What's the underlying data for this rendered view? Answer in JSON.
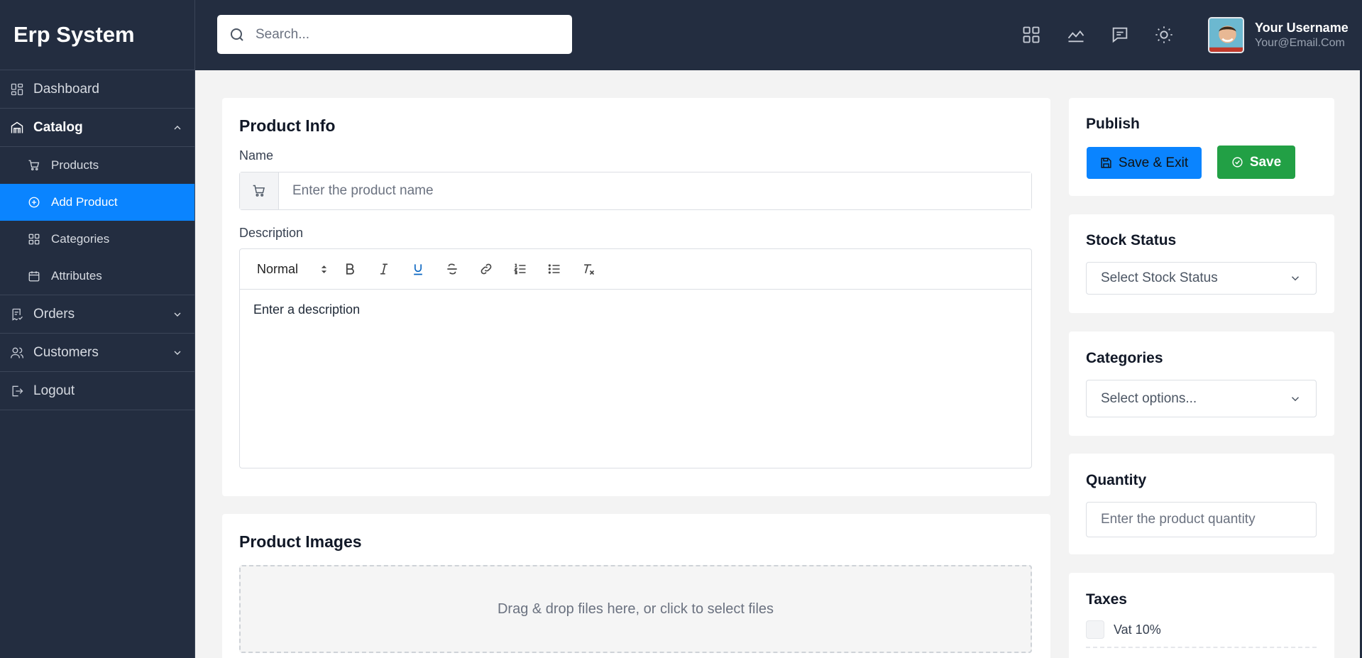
{
  "app": {
    "title": "Erp System"
  },
  "sidebar": {
    "items": [
      {
        "label": "Dashboard",
        "icon": "dashboard-icon"
      },
      {
        "label": "Catalog",
        "icon": "store-icon",
        "expanded": true,
        "children": [
          {
            "label": "Products",
            "icon": "cart-icon"
          },
          {
            "label": "Add Product",
            "icon": "plus-circle-icon",
            "selected": true
          },
          {
            "label": "Categories",
            "icon": "grid-icon"
          },
          {
            "label": "Attributes",
            "icon": "calendar-icon"
          }
        ]
      },
      {
        "label": "Orders",
        "icon": "receipt-icon"
      },
      {
        "label": "Customers",
        "icon": "users-icon"
      },
      {
        "label": "Logout",
        "icon": "logout-icon"
      }
    ]
  },
  "header": {
    "search_placeholder": "Search...",
    "icons": [
      "apps-grid-icon",
      "chart-icon",
      "message-icon",
      "sun-icon"
    ],
    "user": {
      "name": "Your Username",
      "email": "Your@Email.Com"
    }
  },
  "product_info": {
    "title": "Product Info",
    "name_label": "Name",
    "name_placeholder": "Enter the product name",
    "description_label": "Description",
    "editor": {
      "format": "Normal",
      "tools": [
        "bold",
        "italic",
        "underline",
        "strikethrough",
        "link",
        "ordered-list",
        "bullet-list",
        "clear-format"
      ],
      "placeholder": "Enter a description"
    }
  },
  "product_images": {
    "title": "Product Images",
    "dropzone_text": "Drag & drop files here, or click to select files"
  },
  "publish": {
    "title": "Publish",
    "save_exit_label": "Save & Exit",
    "save_label": "Save"
  },
  "stock_status": {
    "title": "Stock Status",
    "placeholder": "Select Stock Status"
  },
  "categories": {
    "title": "Categories",
    "placeholder": "Select options..."
  },
  "quantity": {
    "title": "Quantity",
    "placeholder": "Enter the product quantity"
  },
  "taxes": {
    "title": "Taxes",
    "items": [
      {
        "label": "Vat 10%",
        "checked": false
      }
    ]
  },
  "colors": {
    "sidebar_bg": "#232d40",
    "accent": "#0a84ff",
    "save_green": "#22a045",
    "page_bg": "#f3f3f3"
  }
}
